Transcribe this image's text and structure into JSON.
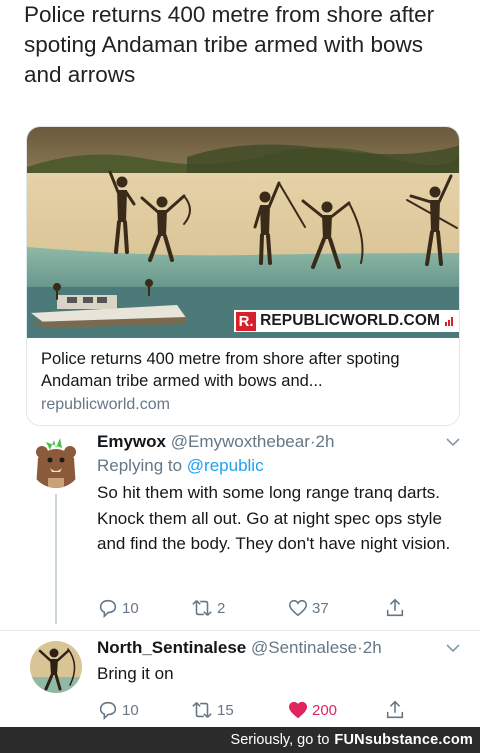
{
  "tweet": {
    "text": "Police returns 400 metre from shore after spoting Andaman tribe armed with bows and arrows"
  },
  "card": {
    "brand_letter": "R.",
    "brand_name": "REPUBLICWORLD.COM",
    "title": "Police returns 400 metre from shore after spoting Andaman tribe armed with bows and...",
    "domain": "republicworld.com"
  },
  "replies": [
    {
      "name": "Emywox",
      "handle": "@Emywoxthebear",
      "separator": "·",
      "time": "2h",
      "replying_prefix": "Replying to",
      "replying_to": "@republic",
      "text": "So hit them with some long range tranq darts. Knock them all out. Go at night spec ops style and find the body. They don't have night vision.",
      "reply_count": "10",
      "retweet_count": "2",
      "like_count": "37",
      "liked": false,
      "avatar_icon": "bear-avatar-icon"
    },
    {
      "name": "North_Sentinalese",
      "handle": "@Sentinalese",
      "separator": "·",
      "time": "2h",
      "text": "Bring it on",
      "reply_count": "10",
      "retweet_count": "15",
      "like_count": "200",
      "liked": true,
      "avatar_icon": "archer-avatar-icon"
    }
  ],
  "footer": {
    "text": "Seriously, go to",
    "site": "FUNsubstance.com"
  },
  "colors": {
    "like_active": "#e0245e",
    "mention": "#1da1f2",
    "muted": "#657786",
    "brand_red": "#d6202a"
  }
}
